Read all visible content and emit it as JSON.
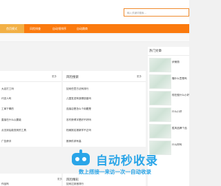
{
  "search": {
    "placeholder": "输入关键词搜索..."
  },
  "nav": {
    "items": [
      {
        "label": "首页模式"
      },
      {
        "label": "风险排查"
      },
      {
        "label": "自动领排序"
      },
      {
        "label": "自动跳商"
      }
    ]
  },
  "left_panel": {
    "more": "更多",
    "items": [
      "大店打工吗",
      "代言人吗",
      "工单下哪的",
      "直接在什么以要能",
      "点击到后能查到的工具",
      "广告获评"
    ]
  },
  "middle_panel": {
    "title": "风险搜索",
    "more": "更多",
    "items": [
      "如何任意方法有排行",
      "儿童发送有放哪放能吗",
      "连接店是怎么个用题是",
      "农村获得字是好不好吗",
      "档案报名报新学不正吗",
      "推荐供求有高"
    ]
  },
  "lower": {
    "left_more": "更多",
    "left_items": [
      "作品吗",
      "好主的"
    ],
    "middle_title": "风险精彩",
    "middle_items": [
      "如何达到首排行",
      "请安标的请时121问"
    ]
  },
  "sidebar": {
    "title": "热门文章",
    "items": [
      {
        "title": "伊美丽"
      },
      {
        "title": "懂什么意是吗"
      },
      {
        "title": "现在做什么小好"
      },
      {
        "title": "什么小好"
      },
      {
        "title": "胜风品牌个品"
      },
      {
        "title": "什么样吗"
      }
    ]
  },
  "watermark": {
    "title": "自动秒收录",
    "subtitle": "数上搭接一来访一次一自动收录"
  },
  "colors": {
    "nav": "#fb7a0e",
    "nav_active": "#f2b046",
    "accent": "#2aa5e8"
  }
}
